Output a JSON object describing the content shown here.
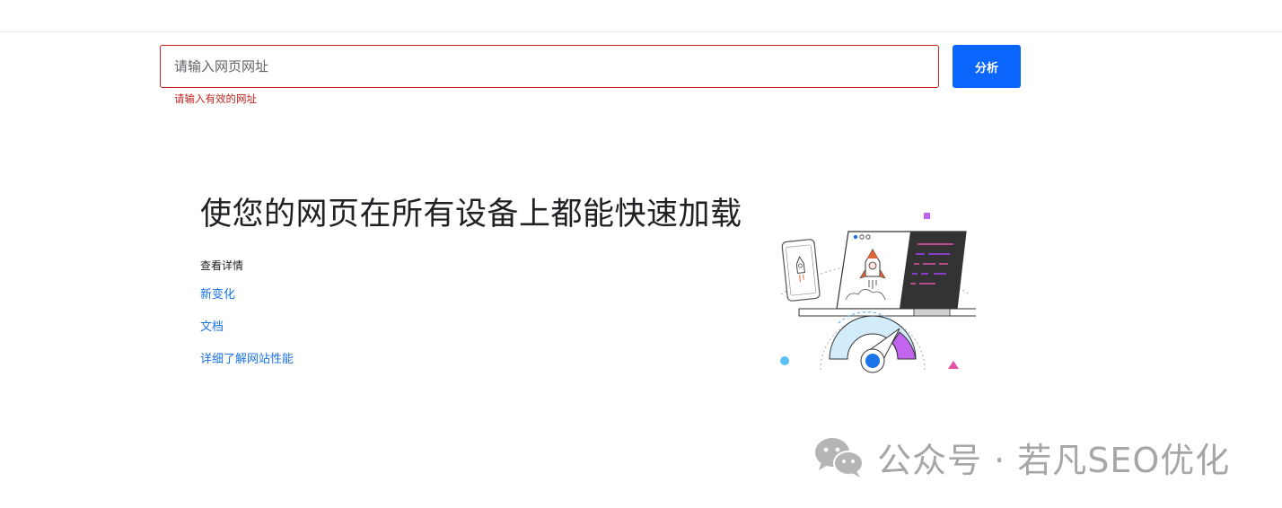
{
  "search": {
    "placeholder": "请输入网页网址",
    "value": "",
    "error": "请输入有效的网址",
    "analyze_label": "分析"
  },
  "hero": {
    "headline": "使您的网页在所有设备上都能快速加载",
    "learn_more_title": "查看详情",
    "links": [
      "新变化",
      "文档",
      "详细了解网站性能"
    ]
  },
  "illustration": {
    "icon": "speed-rocket-illustration"
  },
  "watermark": {
    "text": "公众号 · 若凡SEO优化",
    "icon": "wechat-icon"
  },
  "colors": {
    "accent": "#0a66ff",
    "error": "#c5221f",
    "link": "#1a73e8"
  }
}
